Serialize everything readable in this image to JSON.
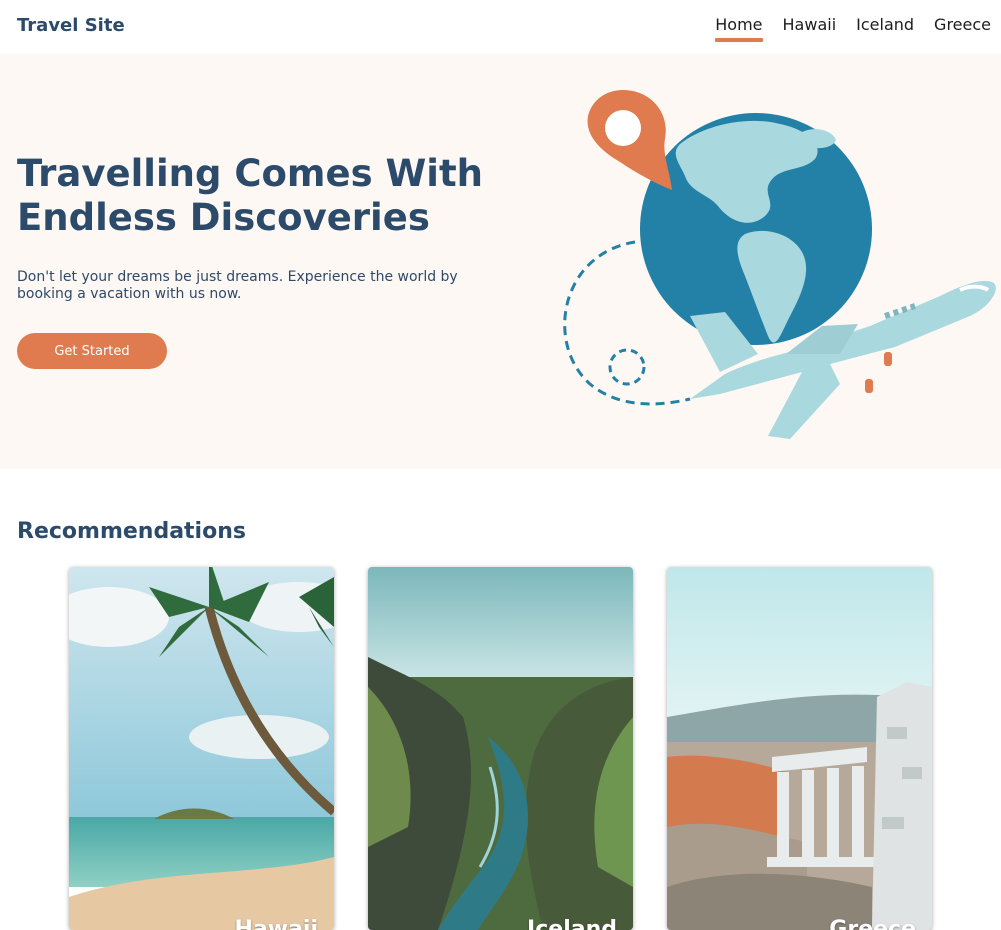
{
  "header": {
    "brand": "Travel Site",
    "nav": [
      {
        "label": "Home",
        "active": true
      },
      {
        "label": "Hawaii",
        "active": false
      },
      {
        "label": "Iceland",
        "active": false
      },
      {
        "label": "Greece",
        "active": false
      }
    ]
  },
  "hero": {
    "title_line1": "Travelling Comes With",
    "title_line2": "Endless Discoveries",
    "subtitle": "Don't let your dreams be just dreams. Experience the world by booking a vacation with us now.",
    "cta_label": "Get Started"
  },
  "recommendations": {
    "title": "Recommendations",
    "cards": [
      {
        "label": "Hawaii",
        "icon": "palm-beach-photo"
      },
      {
        "label": "Iceland",
        "icon": "canyon-river-photo"
      },
      {
        "label": "Greece",
        "icon": "temple-ruins-photo"
      }
    ]
  },
  "colors": {
    "accent": "#e07a4f",
    "heading": "#2c4a6a",
    "hero_bg": "#fdf8f3",
    "globe": "#2380a6",
    "land": "#a9d8de"
  }
}
